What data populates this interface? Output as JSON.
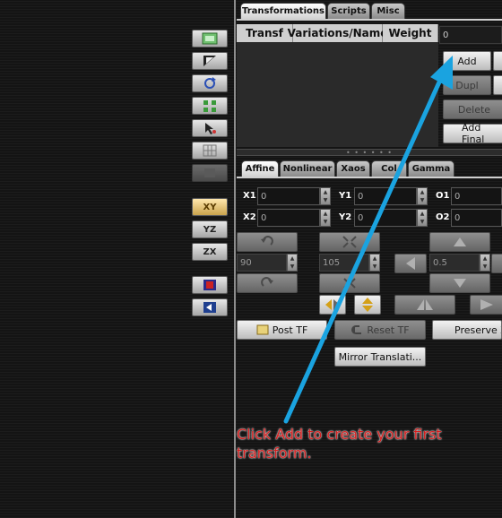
{
  "tabs": {
    "transformations": "Transformations",
    "scripts": "Scripts",
    "misc": "Misc"
  },
  "grid": {
    "columns": [
      "Transf",
      "Variations/Name",
      "Weight"
    ],
    "weight_value": "0"
  },
  "buttons": {
    "add": "Add",
    "dupl": "Dupl",
    "delete": "Delete",
    "add_final": "Add Final"
  },
  "subtabs": [
    "Affine",
    "Nonlinear",
    "Xaos",
    "Col",
    "Gamma"
  ],
  "coords": {
    "x1": {
      "label": "X1",
      "value": "0"
    },
    "x2": {
      "label": "X2",
      "value": "0"
    },
    "y1": {
      "label": "Y1",
      "value": "0"
    },
    "y2": {
      "label": "Y2",
      "value": "0"
    },
    "o1": {
      "label": "O1",
      "value": "0"
    },
    "o2": {
      "label": "O2",
      "value": "0"
    }
  },
  "rotate_value": "90",
  "scale_value": "105",
  "move_value": "0.5",
  "bottom_buttons": {
    "post_tf": "Post TF",
    "reset_tf": "Reset TF",
    "preserve_z": "Preserve Z",
    "mirror_translation": "Mirror Translati..."
  },
  "toolbar": {
    "xy": "XY",
    "yz": "YZ",
    "zx": "ZX"
  },
  "annotation": "Click Add to create your first transform.",
  "colors": {
    "annotation_text": "#d42020",
    "arrow": "#1aa3e0",
    "divider": "#8c8c8c"
  }
}
